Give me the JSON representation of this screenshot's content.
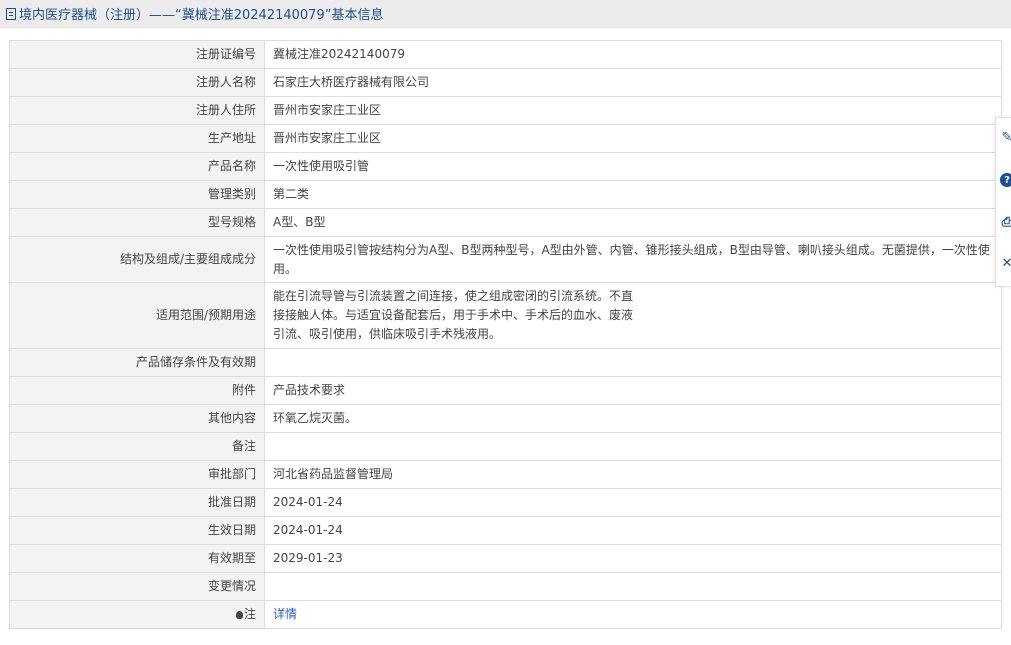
{
  "header": {
    "title": "境内医疗器械（注册）——“冀械注准20242140079”基本信息"
  },
  "rows": [
    {
      "label": "注册证编号",
      "value": "冀械注准20242140079"
    },
    {
      "label": "注册人名称",
      "value": "石家庄大桥医疗器械有限公司"
    },
    {
      "label": "注册人住所",
      "value": "晋州市安家庄工业区"
    },
    {
      "label": "生产地址",
      "value": "晋州市安家庄工业区"
    },
    {
      "label": "产品名称",
      "value": "一次性使用吸引管"
    },
    {
      "label": "管理类别",
      "value": "第二类"
    },
    {
      "label": "型号规格",
      "value": "A型、B型"
    },
    {
      "label": "结构及组成/主要组成成分",
      "value": "一次性使用吸引管按结构分为A型、B型两种型号，A型由外管、内管、锥形接头组成，B型由导管、喇叭接头组成。无菌提供，一次性使用。"
    },
    {
      "label": "适用范围/预期用途",
      "lines": [
        "能在引流导管与引流装置之间连接，使之组成密闭的引流系统。不直",
        "接接触人体。与适宜设备配套后，用于手术中、手术后的血水、废液",
        "引流、吸引使用，供临床吸引手术残液用。"
      ]
    },
    {
      "label": "产品储存条件及有效期",
      "value": ""
    },
    {
      "label": "附件",
      "value": "产品技术要求"
    },
    {
      "label": "其他内容",
      "value": "环氧乙烷灭菌。"
    },
    {
      "label": "备注",
      "value": ""
    },
    {
      "label": "审批部门",
      "value": "河北省药品监督管理局"
    },
    {
      "label": "批准日期",
      "value": "2024-01-24"
    },
    {
      "label": "生效日期",
      "value": "2024-01-24"
    },
    {
      "label": "有效期至",
      "value": "2029-01-23"
    },
    {
      "label": "变更情况",
      "value": ""
    },
    {
      "label": "注",
      "value": "详情"
    }
  ],
  "icons": {
    "header": "document-icon",
    "note": "bulb-icon",
    "side": [
      "edit-icon",
      "help-icon",
      "print-icon",
      "close-icon"
    ]
  },
  "colors": {
    "header_text": "#1f4f8f",
    "link": "#2a62c8",
    "label_bg": "#f3f3f3"
  }
}
